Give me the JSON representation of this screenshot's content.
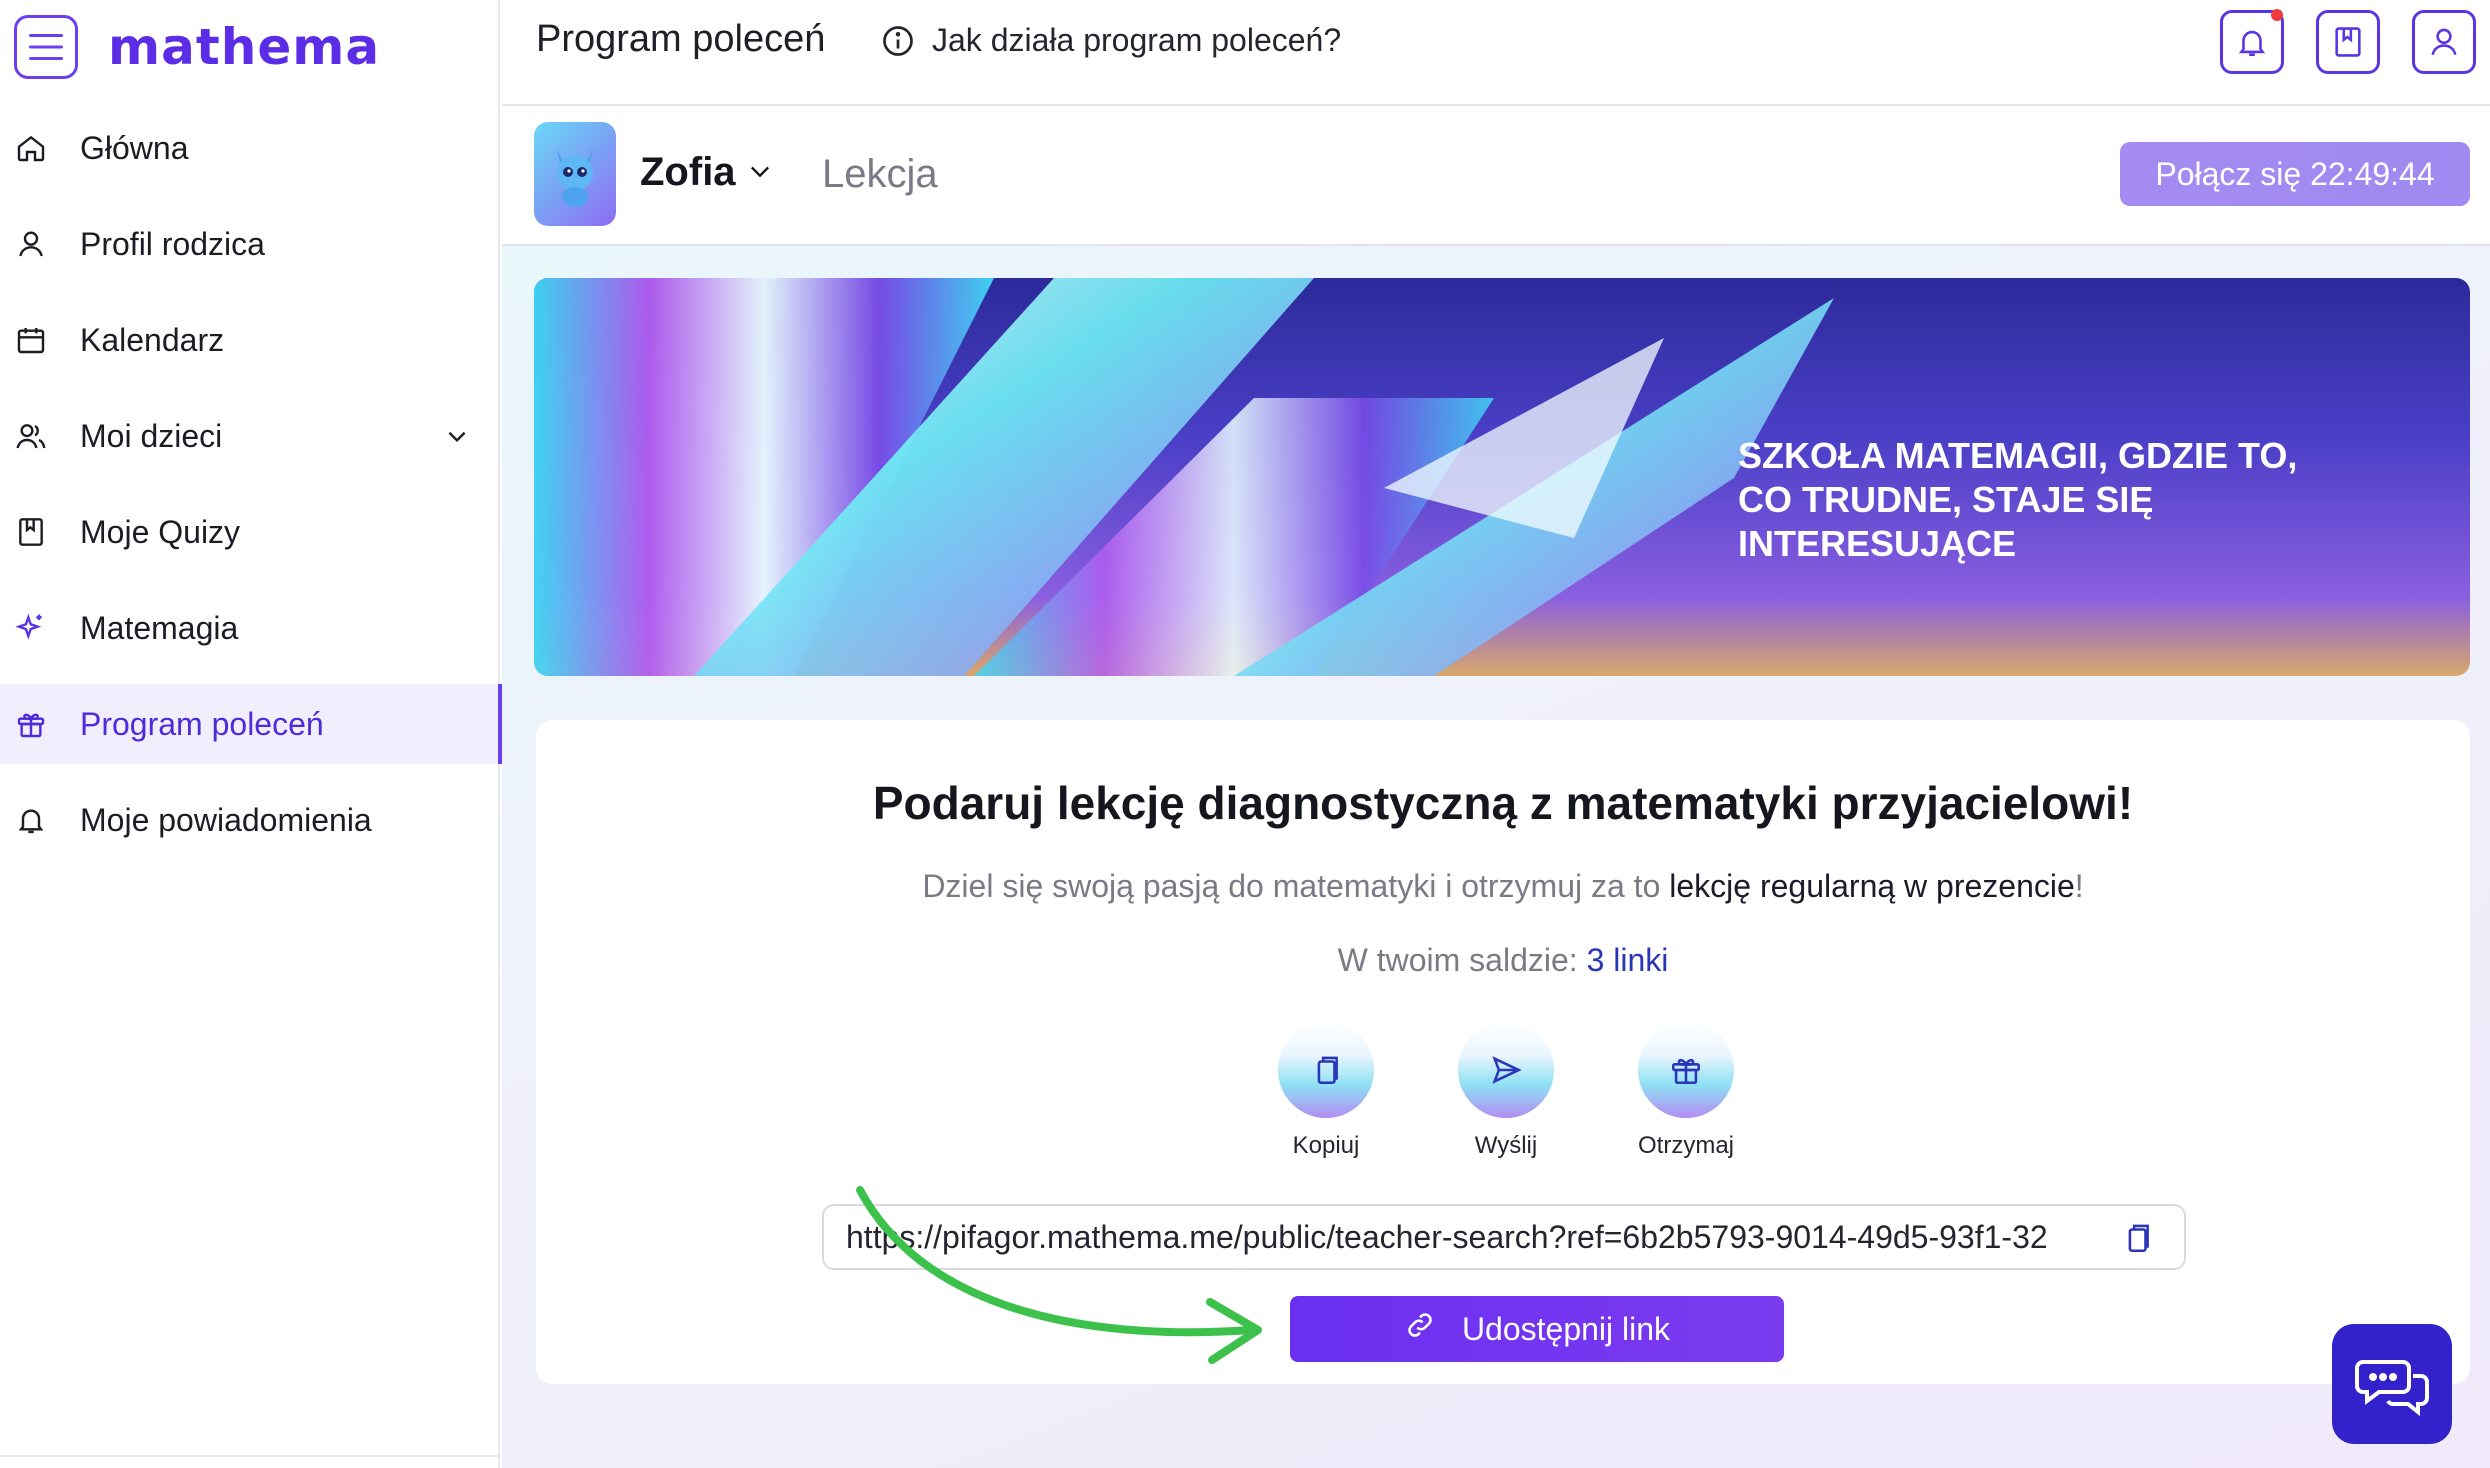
{
  "app": {
    "logo": "mathema"
  },
  "sidebar": {
    "items": [
      {
        "label": "Główna",
        "icon": "home-icon"
      },
      {
        "label": "Profil rodzica",
        "icon": "user-icon"
      },
      {
        "label": "Kalendarz",
        "icon": "calendar-icon"
      },
      {
        "label": "Moi dzieci",
        "icon": "children-icon"
      },
      {
        "label": "Moje Quizy",
        "icon": "bookmark-icon"
      },
      {
        "label": "Matemagia",
        "icon": "sparkle-icon"
      },
      {
        "label": "Program poleceń",
        "icon": "gift-icon",
        "active": true
      },
      {
        "label": "Moje powiadomienia",
        "icon": "bell-icon"
      }
    ]
  },
  "header": {
    "title": "Program poleceń",
    "help_link": "Jak działa program poleceń?"
  },
  "subheader": {
    "child_name": "Zofia",
    "lesson_tab": "Lekcja",
    "connect_button": "Połącz się 22:49:44"
  },
  "banner": {
    "line1": "SZKOŁA MATEMAGII, GDZIE TO,",
    "line2": "CO TRUDNE, STAJE SIĘ INTERESUJĄCE"
  },
  "referral": {
    "title": "Podaruj lekcję diagnostyczną z matematyki przyjacielowi!",
    "subtitle_prefix": "Dziel się swoją pasją do matematyki i otrzymuj za to ",
    "subtitle_bold": "lekcję regularną w prezencie",
    "subtitle_suffix": "!",
    "balance_label": "W twoim saldzie: ",
    "balance_value": "3 linki",
    "actions": [
      {
        "label": "Kopiuj",
        "icon": "copy-icon"
      },
      {
        "label": "Wyślij",
        "icon": "send-icon"
      },
      {
        "label": "Otrzymaj",
        "icon": "gift-icon"
      }
    ],
    "link_value": "https://pifagor.mathema.me/public/teacher-search?ref=6b2b5793-9014-49d5-93f1-32",
    "share_button": "Udostępnij link"
  },
  "colors": {
    "accent": "#6b3ff0",
    "share_button": "#6b2ff0",
    "arrow": "#3cc24a",
    "chat_fab": "#3322cc"
  }
}
